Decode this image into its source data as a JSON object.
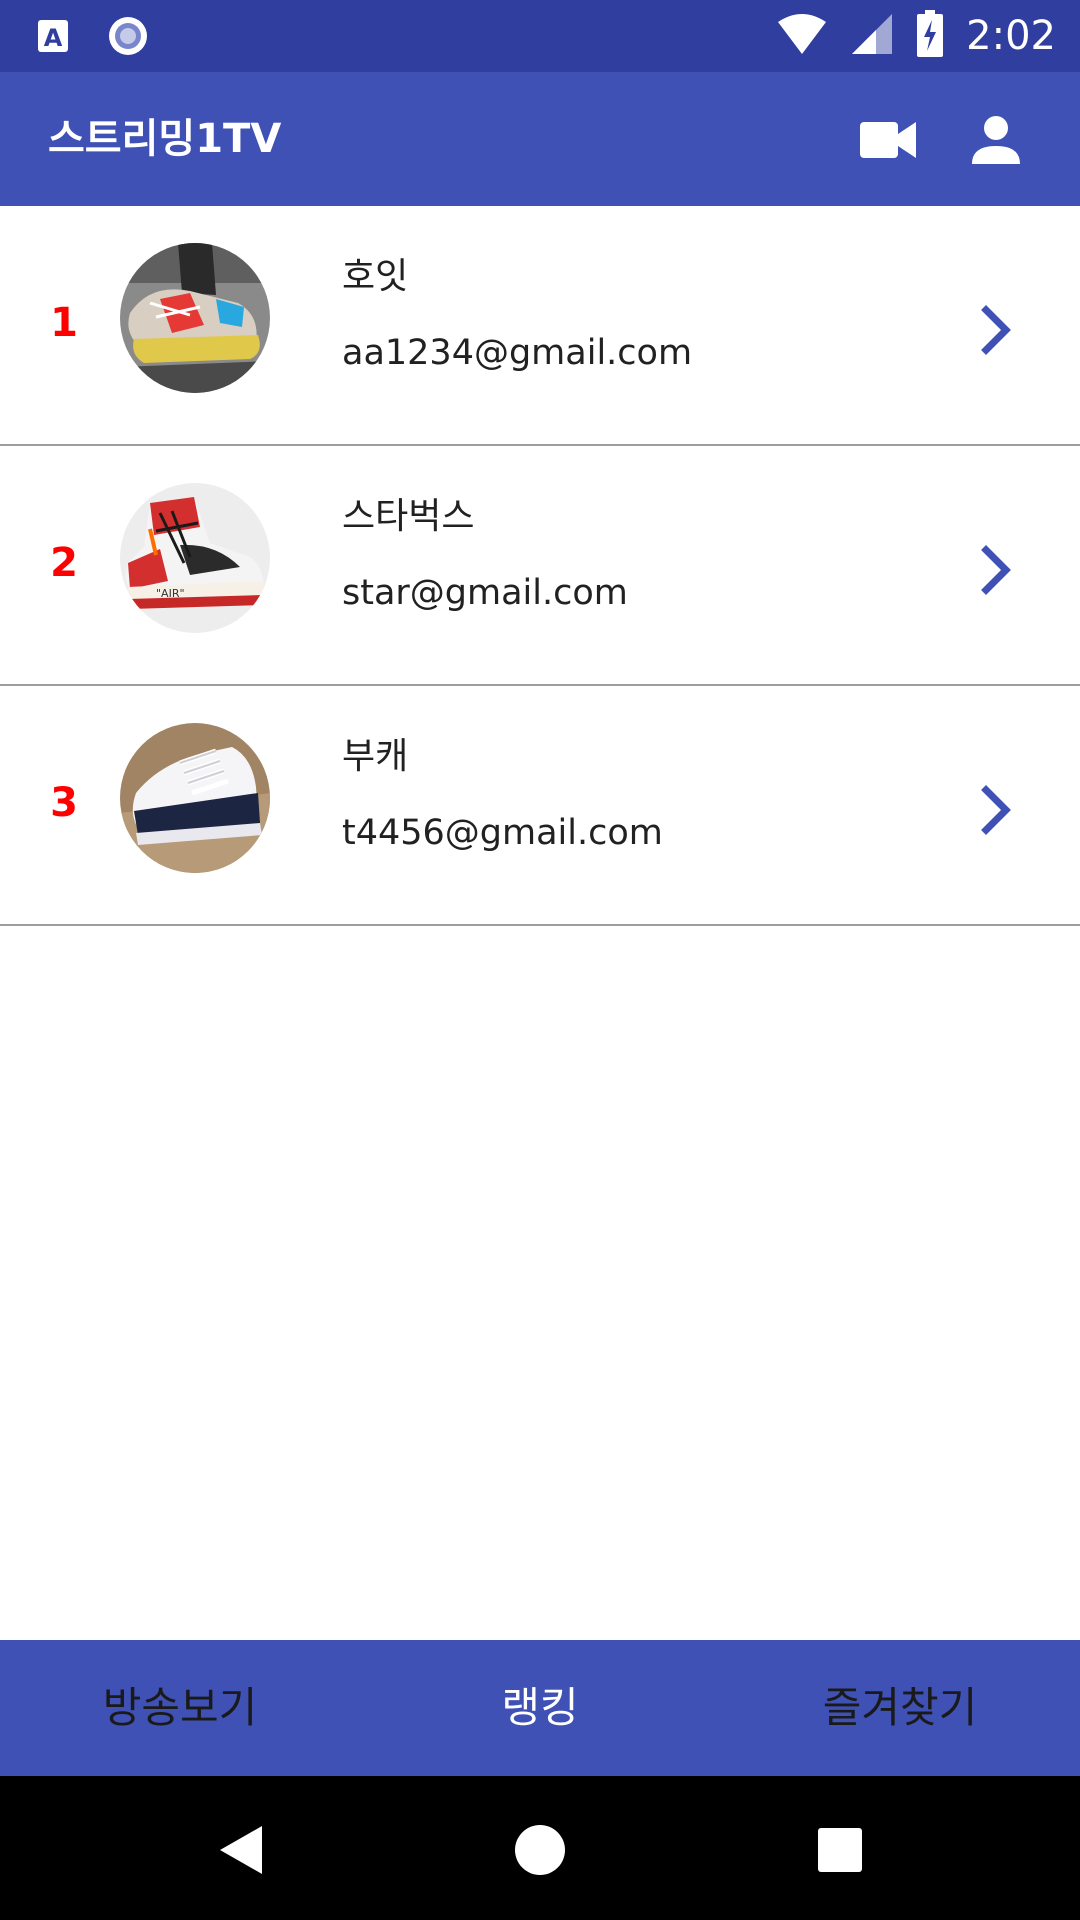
{
  "status_bar": {
    "time": "2:02",
    "icons": [
      "app-a-icon",
      "circle-app-icon",
      "wifi-icon",
      "cell-signal-icon",
      "battery-charging-icon"
    ]
  },
  "app_bar": {
    "title": "스트리밍1TV",
    "actions": [
      "video-camera-icon",
      "account-icon"
    ]
  },
  "ranking": [
    {
      "rank": "1",
      "name": "호잇",
      "email": "aa1234@gmail.com",
      "avatar": "sneaker-gray-red-blue"
    },
    {
      "rank": "2",
      "name": "스타벅스",
      "email": "star@gmail.com",
      "avatar": "sneaker-red-white-high"
    },
    {
      "rank": "3",
      "name": "부캐",
      "email": "t4456@gmail.com",
      "avatar": "sneaker-white-navy-high"
    }
  ],
  "bottom_nav": {
    "items": [
      "방송보기",
      "랭킹",
      "즐겨찾기"
    ],
    "active": "랭킹"
  },
  "colors": {
    "status_bar": "#303f9f",
    "primary": "#3f51b5",
    "rank": "#ff0000",
    "chevron": "#3f51b5"
  }
}
